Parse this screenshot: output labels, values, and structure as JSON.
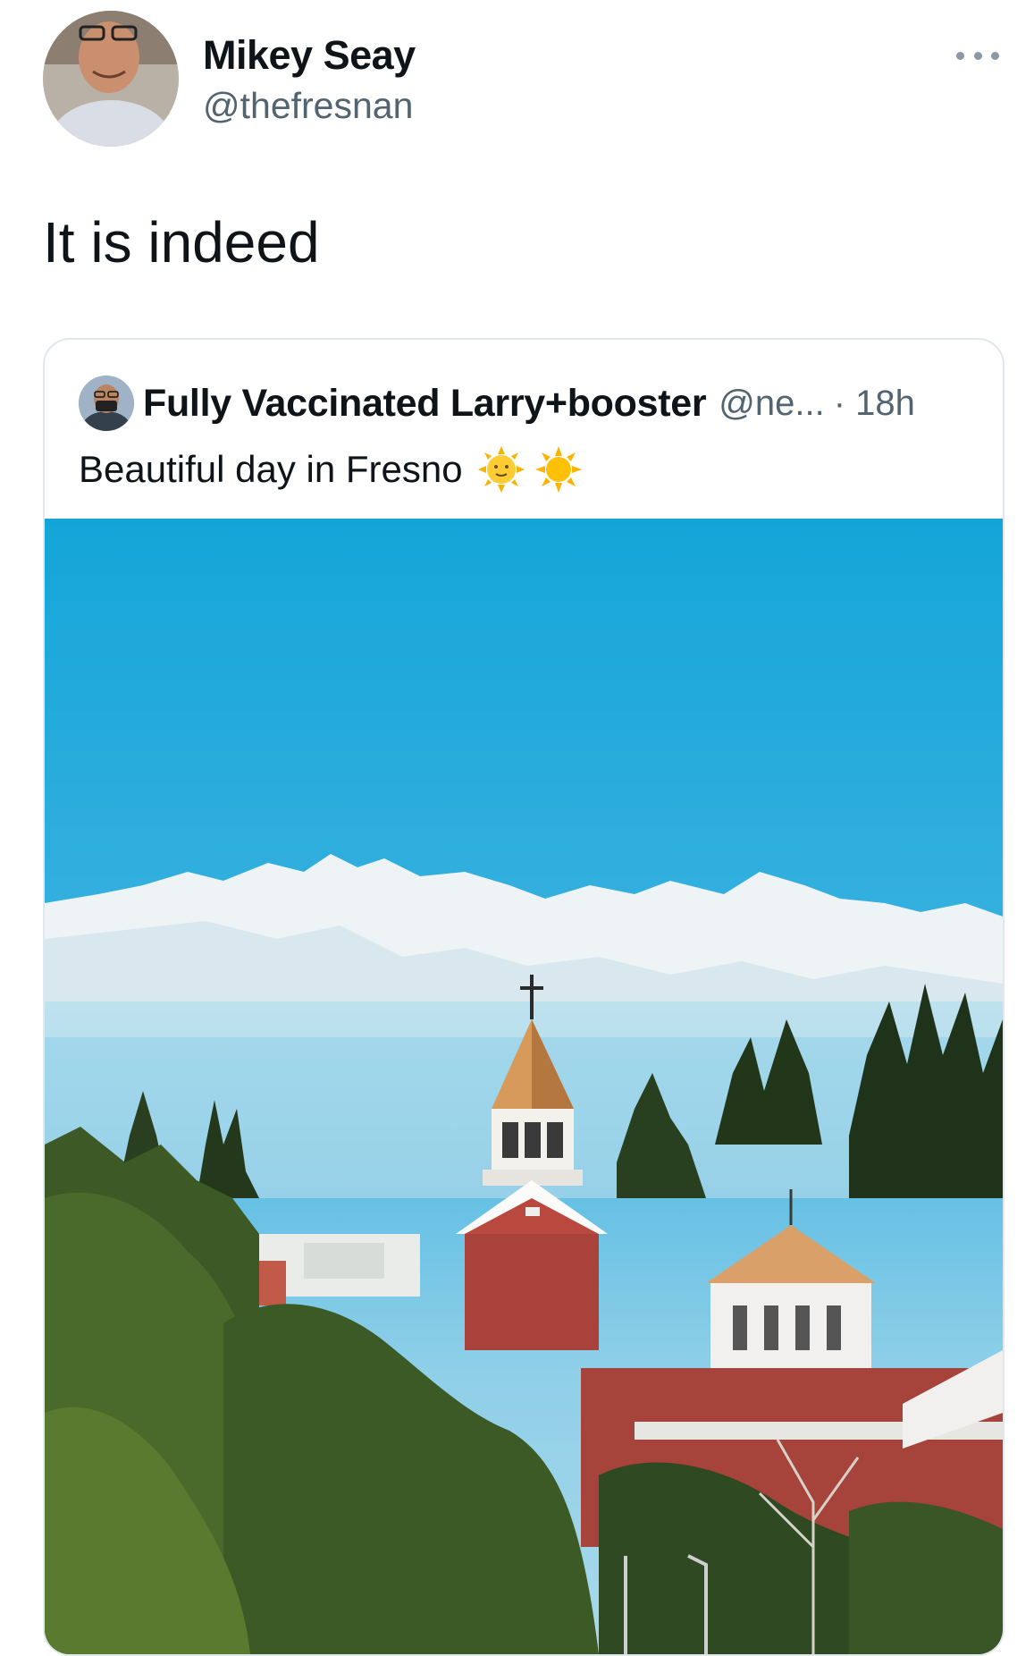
{
  "tweet": {
    "author": {
      "display_name": "Mikey Seay",
      "handle": "@thefresnan"
    },
    "text": "It is indeed",
    "more_icon": "more-dots-icon"
  },
  "quoted_tweet": {
    "author": {
      "display_name": "Fully Vaccinated Larry+booster",
      "handle": "@ne...",
      "time": "· 18h"
    },
    "text": "Beautiful day in Fresno",
    "emojis": [
      "sun-with-face-emoji",
      "sun-emoji"
    ],
    "photo": {
      "sky_color": "#1aa6d6",
      "mountain_color": "#eef2f5",
      "tree_color": "#2f4a22",
      "church_roof_color": "#d79a5a",
      "brick_color": "#a7423a"
    }
  }
}
